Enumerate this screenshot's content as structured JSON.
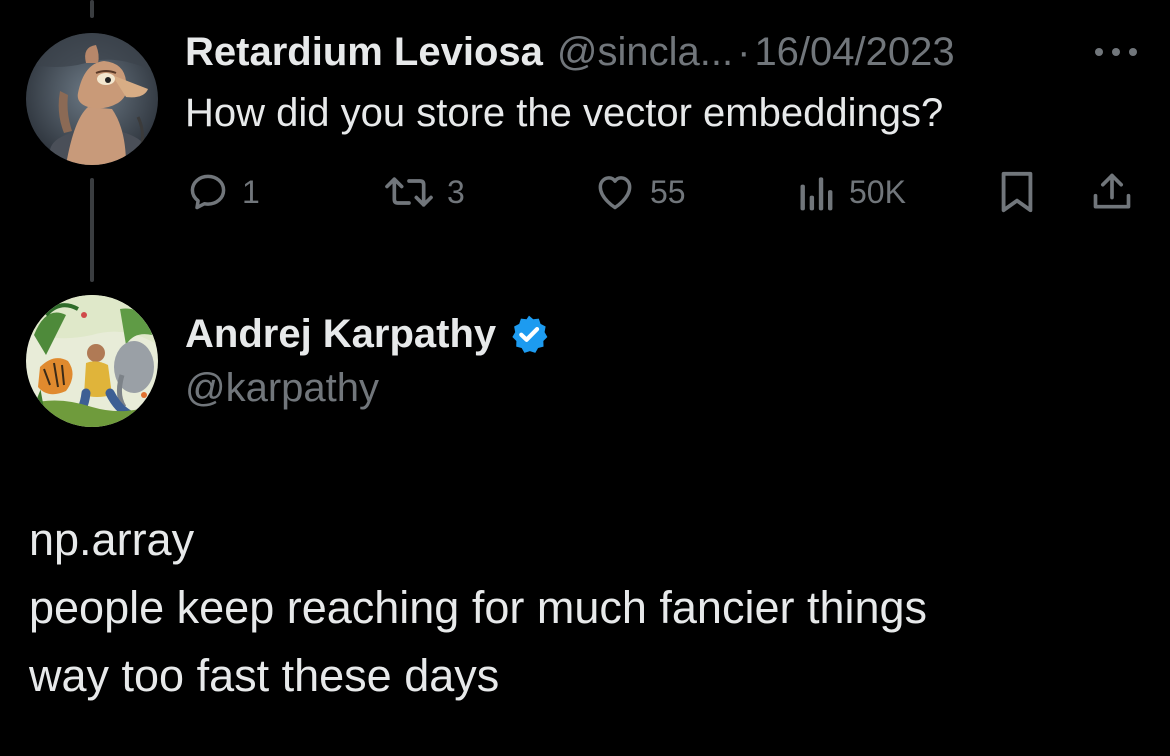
{
  "reply_tweet": {
    "display_name": "Retardium Leviosa",
    "handle": "@sincla...",
    "separator": "·",
    "date": "16/04/2023",
    "text": "How did you store the vector embeddings?",
    "actions": {
      "replies": "1",
      "retweets": "3",
      "likes": "55",
      "views": "50K"
    },
    "more_icon": "more-dots-icon"
  },
  "main_tweet": {
    "display_name": "Andrej Karpathy",
    "handle": "@karpathy",
    "verified": true,
    "lines": [
      "np.array",
      "people keep reaching for much fancier things",
      "way too fast these days"
    ]
  },
  "colors": {
    "background": "#000000",
    "text_primary": "#e7e9ea",
    "text_secondary": "#71767b",
    "verified_blue": "#1d9bf0",
    "thread_line": "#3a3d40"
  },
  "icons": {
    "reply": "reply-bubble-icon",
    "retweet": "retweet-icon",
    "like": "heart-icon",
    "views": "views-bar-chart-icon",
    "bookmark": "bookmark-icon",
    "share": "share-upload-icon",
    "verified": "verified-badge-icon"
  }
}
